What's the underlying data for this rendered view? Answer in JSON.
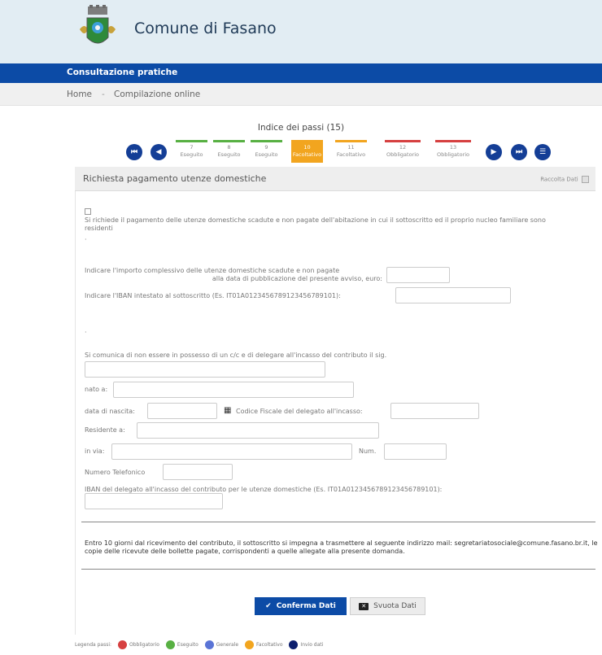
{
  "header": {
    "title": "Comune di Fasano"
  },
  "section_bar": {
    "title": "Consultazione pratiche"
  },
  "breadcrumb": {
    "home": "Home",
    "separator": "-",
    "current": "Compilazione online"
  },
  "steps": {
    "title": "Indice dei passi (15)",
    "items": [
      {
        "num": "7",
        "label": "Eseguito",
        "status": "green"
      },
      {
        "num": "8",
        "label": "Eseguito",
        "status": "green"
      },
      {
        "num": "9",
        "label": "Eseguito",
        "status": "green"
      },
      {
        "num": "10",
        "label": "Facoltativo",
        "status": "active"
      },
      {
        "num": "11",
        "label": "Facoltativo",
        "status": "orange"
      },
      {
        "num": "12",
        "label": "Obbligatorio",
        "status": "red"
      },
      {
        "num": "13",
        "label": "Obbligatorio",
        "status": "red"
      }
    ]
  },
  "panel": {
    "title": "Richiesta pagamento utenze domestiche",
    "action": "Raccolta Dati"
  },
  "form": {
    "request_text": "Si richiede il pagamento delle utenze domestiche scadute e non pagate dell'abitazione in cui il sottoscritto ed il proprio nucleo familiare sono residenti",
    "amount_label_1": "Indicare l'importo complessivo delle utenze domestiche scadute e non pagate",
    "amount_label_2": "alla data di pubblicazione del presente avviso, euro:",
    "iban_label": "Indicare l'IBAN intestato al sottoscritto (Es. IT01A0123456789123456789101):",
    "delegate_label": "Si comunica di non essere in possesso di un c/c e di delegare all'incasso del contributo il sig.",
    "born_label": "nato a:",
    "birth_date_label": "data di nascita:",
    "tax_code_label": "Codice Fiscale del delegato all'incasso:",
    "resident_label": "Residente a:",
    "street_label": "in via:",
    "number_label": "Num.",
    "phone_label": "Numero Telefonico",
    "delegate_iban_label": "IBAN del delegato all'incasso del contributo per le utenze domestiche (Es. IT01A0123456789123456789101):"
  },
  "notice": "Entro 10 giorni dal ricevimento del contributo, il sottoscritto si impegna a trasmettere al seguente indirizzo mail: segretariatosociale@comune.fasano.br.it, le copie delle ricevute delle bollette pagate, corrispondenti a quelle allegate alla presente domanda.",
  "buttons": {
    "confirm": "Conferma Dati",
    "clear": "Svuota Dati"
  },
  "legend": {
    "label": "Legenda passi:",
    "items": [
      {
        "label": "Obbligatorio",
        "color": "#d64040"
      },
      {
        "label": "Eseguito",
        "color": "#58b043"
      },
      {
        "label": "Generale",
        "color": "#5a74d6"
      },
      {
        "label": "Facoltativo",
        "color": "#f2a51f"
      },
      {
        "label": "Invio dati",
        "color": "#0d1f6e"
      }
    ]
  }
}
